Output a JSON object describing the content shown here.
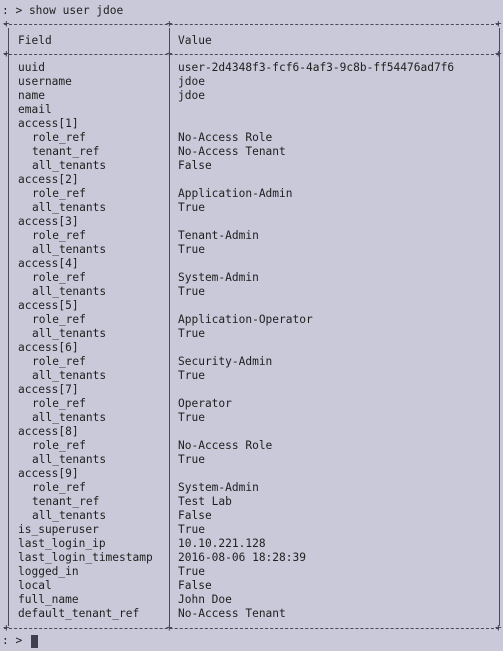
{
  "terminal": {
    "command_line": ": > show user jdoe",
    "prompt": ": >"
  },
  "table": {
    "headers": [
      "Field",
      "Value"
    ],
    "rows": [
      {
        "field": "uuid",
        "value": "user-2d4348f3-fcf6-4af3-9c8b-ff54476ad7f6",
        "indent": false
      },
      {
        "field": "username",
        "value": "jdoe",
        "indent": false
      },
      {
        "field": "name",
        "value": "jdoe",
        "indent": false
      },
      {
        "field": "email",
        "value": "",
        "indent": false
      },
      {
        "field": "access[1]",
        "value": "",
        "indent": false
      },
      {
        "field": "role_ref",
        "value": "No-Access Role",
        "indent": true
      },
      {
        "field": "tenant_ref",
        "value": "No-Access Tenant",
        "indent": true
      },
      {
        "field": "all_tenants",
        "value": "False",
        "indent": true
      },
      {
        "field": "access[2]",
        "value": "",
        "indent": false
      },
      {
        "field": "role_ref",
        "value": "Application-Admin",
        "indent": true
      },
      {
        "field": "all_tenants",
        "value": "True",
        "indent": true
      },
      {
        "field": "access[3]",
        "value": "",
        "indent": false
      },
      {
        "field": "role_ref",
        "value": "Tenant-Admin",
        "indent": true
      },
      {
        "field": "all_tenants",
        "value": "True",
        "indent": true
      },
      {
        "field": "access[4]",
        "value": "",
        "indent": false
      },
      {
        "field": "role_ref",
        "value": "System-Admin",
        "indent": true
      },
      {
        "field": "all_tenants",
        "value": "True",
        "indent": true
      },
      {
        "field": "access[5]",
        "value": "",
        "indent": false
      },
      {
        "field": "role_ref",
        "value": "Application-Operator",
        "indent": true
      },
      {
        "field": "all_tenants",
        "value": "True",
        "indent": true
      },
      {
        "field": "access[6]",
        "value": "",
        "indent": false
      },
      {
        "field": "role_ref",
        "value": "Security-Admin",
        "indent": true
      },
      {
        "field": "all_tenants",
        "value": "True",
        "indent": true
      },
      {
        "field": "access[7]",
        "value": "",
        "indent": false
      },
      {
        "field": "role_ref",
        "value": "Operator",
        "indent": true
      },
      {
        "field": "all_tenants",
        "value": "True",
        "indent": true
      },
      {
        "field": "access[8]",
        "value": "",
        "indent": false
      },
      {
        "field": "role_ref",
        "value": "No-Access Role",
        "indent": true
      },
      {
        "field": "all_tenants",
        "value": "True",
        "indent": true
      },
      {
        "field": "access[9]",
        "value": "",
        "indent": false
      },
      {
        "field": "role_ref",
        "value": "System-Admin",
        "indent": true
      },
      {
        "field": "tenant_ref",
        "value": "Test Lab",
        "indent": true
      },
      {
        "field": "all_tenants",
        "value": "False",
        "indent": true
      },
      {
        "field": "is_superuser",
        "value": "True",
        "indent": false
      },
      {
        "field": "last_login_ip",
        "value": "10.10.221.128",
        "indent": false
      },
      {
        "field": "last_login_timestamp",
        "value": "2016-08-06 18:28:39",
        "indent": false
      },
      {
        "field": "logged_in",
        "value": "True",
        "indent": false
      },
      {
        "field": "local",
        "value": "False",
        "indent": false
      },
      {
        "field": "full_name",
        "value": "John Doe",
        "indent": false
      },
      {
        "field": "default_tenant_ref",
        "value": "No-Access Tenant",
        "indent": false
      }
    ]
  },
  "colors": {
    "background": "#c9c9d9",
    "text": "#1f1f1f",
    "cursor": "#3f3f4f"
  }
}
